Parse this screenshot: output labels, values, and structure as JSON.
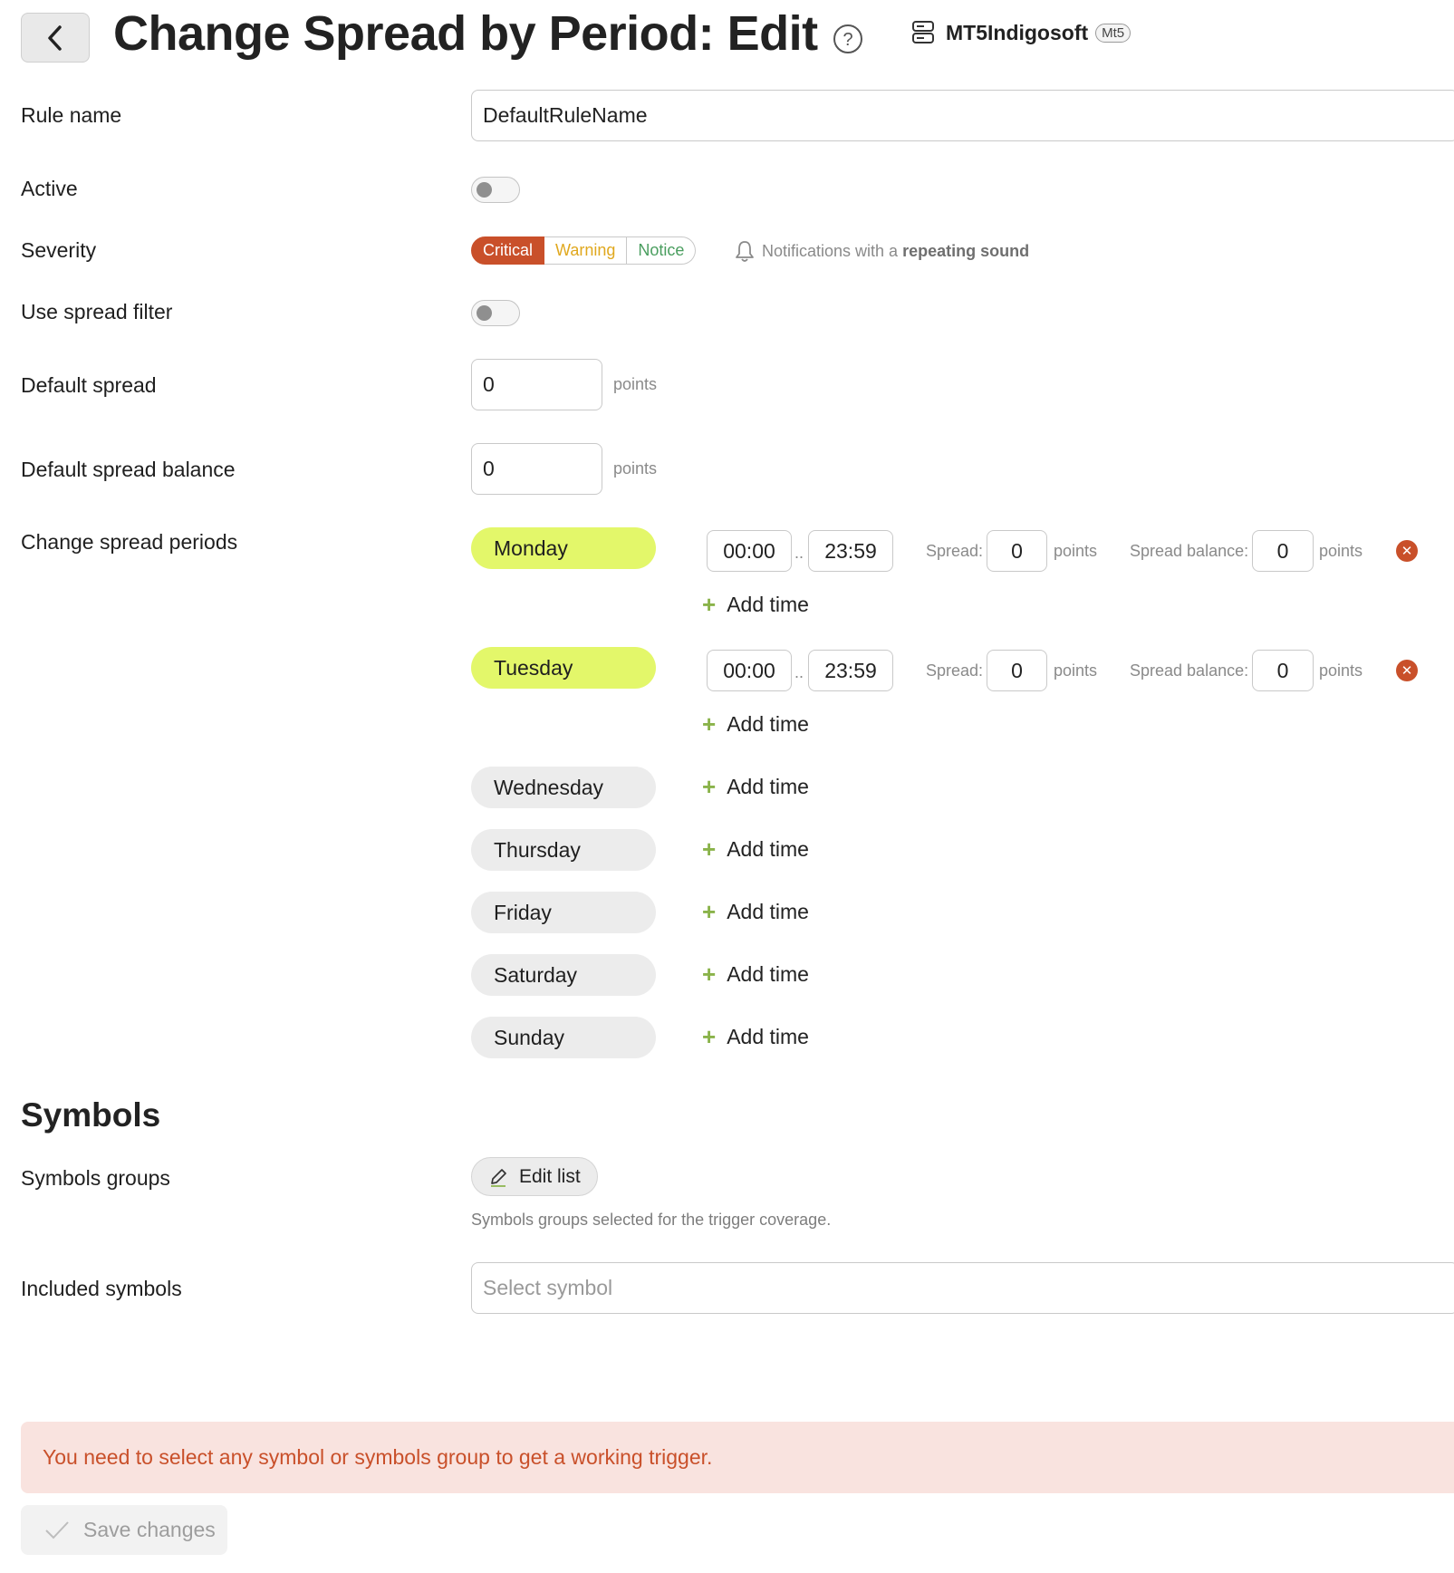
{
  "header": {
    "title": "Change Spread by Period: Edit",
    "server_name": "MT5Indigosoft",
    "server_badge": "Mt5"
  },
  "form": {
    "rule_name": {
      "label": "Rule name",
      "value": "DefaultRuleName"
    },
    "active": {
      "label": "Active",
      "enabled": false
    },
    "severity": {
      "label": "Severity",
      "options": [
        "Critical",
        "Warning",
        "Notice"
      ],
      "selected": "Critical",
      "notification_text": "Notifications with a",
      "notification_bold": "repeating sound"
    },
    "use_spread_filter": {
      "label": "Use spread filter",
      "enabled": false
    },
    "default_spread": {
      "label": "Default spread",
      "value": "0",
      "unit": "points"
    },
    "default_spread_balance": {
      "label": "Default spread balance",
      "value": "0",
      "unit": "points"
    }
  },
  "periods": {
    "label": "Change spread periods",
    "add_time_label": "Add time",
    "spread_label": "Spread:",
    "spread_balance_label": "Spread balance:",
    "unit": "points",
    "separator": "..",
    "days": [
      {
        "name": "Monday",
        "active": true,
        "start": "00:00",
        "end": "23:59",
        "spread": "0",
        "spread_balance": "0"
      },
      {
        "name": "Tuesday",
        "active": true,
        "start": "00:00",
        "end": "23:59",
        "spread": "0",
        "spread_balance": "0"
      },
      {
        "name": "Wednesday",
        "active": false
      },
      {
        "name": "Thursday",
        "active": false
      },
      {
        "name": "Friday",
        "active": false
      },
      {
        "name": "Saturday",
        "active": false
      },
      {
        "name": "Sunday",
        "active": false
      }
    ]
  },
  "symbols": {
    "section_title": "Symbols",
    "groups_label": "Symbols groups",
    "edit_list_label": "Edit list",
    "groups_hint": "Symbols groups selected for the trigger coverage.",
    "included_label": "Included symbols",
    "select_placeholder": "Select symbol"
  },
  "alert": {
    "text": "You need to select any symbol or symbols group to get a working trigger."
  },
  "footer": {
    "save_label": "Save changes"
  },
  "colors": {
    "accent_critical": "#c9502a",
    "warning": "#e0a81e",
    "notice": "#4a9e5f",
    "day_active": "#e3f76a",
    "alert_bg": "#f9e3df"
  }
}
